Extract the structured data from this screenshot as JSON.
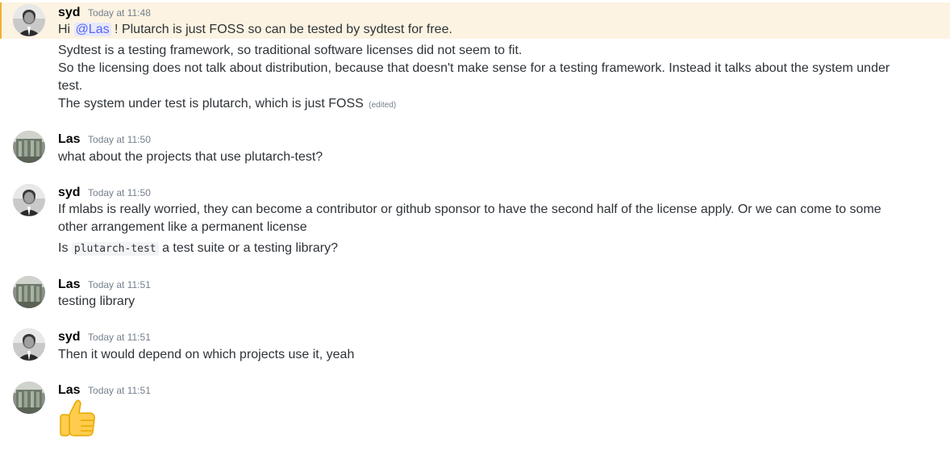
{
  "messages": [
    {
      "author": "syd",
      "timestamp": "Today at 11:48",
      "highlighted": true,
      "mention": "@Las",
      "line1_pre": "Hi ",
      "line1_post": " ! Plutarch is just FOSS so can be tested by sydtest for free."
    },
    {
      "lines": [
        "Sydtest is a testing framework, so traditional software licenses did not seem to fit.",
        "So the licensing does not talk about distribution, because that doesn't make sense for a testing framework. Instead it talks about the system under test.",
        "The system under test is plutarch, which is just FOSS"
      ],
      "edited_label": "(edited)"
    },
    {
      "author": "Las",
      "timestamp": "Today at 11:50",
      "text": "what about the projects that use plutarch-test?"
    },
    {
      "author": "syd",
      "timestamp": "Today at 11:50",
      "text": "If mlabs is really worried, they can become a contributor or github sponsor to have the second half of the license apply. Or we can come to some other arrangement like a permanent license",
      "q_pre": "Is ",
      "q_code": "plutarch-test",
      "q_post": " a test suite or a testing library?"
    },
    {
      "author": "Las",
      "timestamp": "Today at 11:51",
      "text": "testing library"
    },
    {
      "author": "syd",
      "timestamp": "Today at 11:51",
      "text": "Then it would depend on which projects use it, yeah"
    },
    {
      "author": "Las",
      "timestamp": "Today at 11:51",
      "emoji": "thumbs-up"
    }
  ],
  "colors": {
    "highlight_bg": "#fdf3e2",
    "highlight_border": "#f0b132",
    "mention": "#5865f2",
    "timestamp": "#747f8d"
  }
}
